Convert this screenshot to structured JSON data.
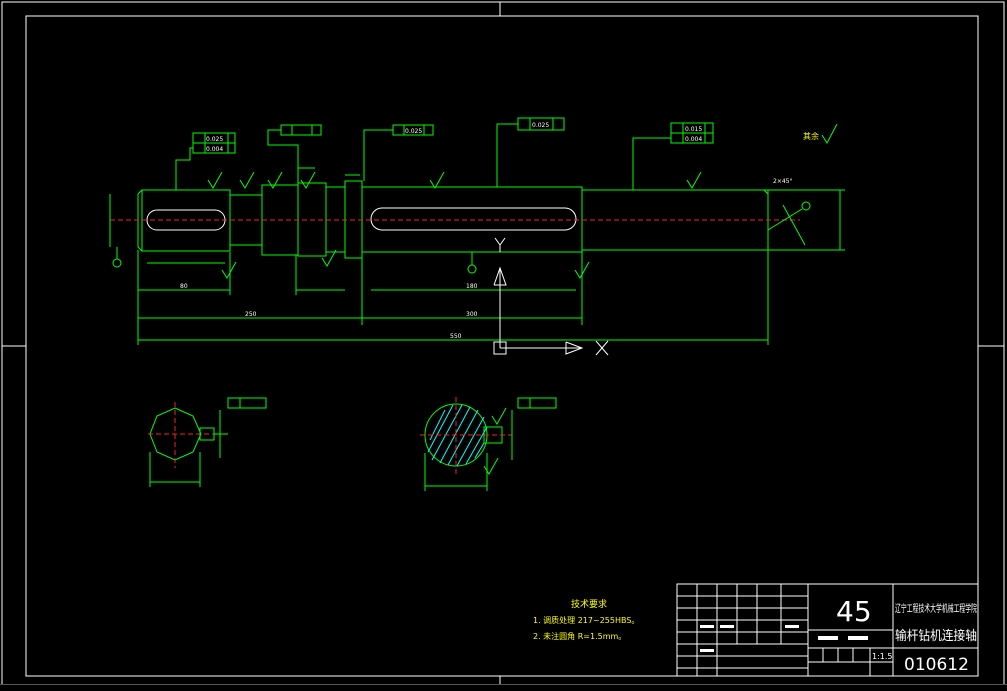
{
  "drawing": {
    "material": "45",
    "scale": "1:1.5",
    "drawing_number": "010612",
    "school": "辽宁工程技术大学机械工程学院",
    "part_name": "输杆钻机连接轴",
    "surface_finish_note": "其余",
    "tech_title": "技术要求",
    "tech_req_1": "1. 调质处理 217~255HBS。",
    "tech_req_2": "2. 未注圆角 R=1.5mm。"
  },
  "dimensions": {
    "overall": "550",
    "left_part": "250",
    "right_part": "300",
    "keyway_long": "180",
    "keyway_short": "80",
    "chamfer": "2×45°",
    "runout_1": "0.025",
    "runout_2": "0.025",
    "runout_3": "0.025",
    "runout_4": "0.015",
    "cyl_tol": "0.004"
  },
  "colors": {
    "background": "#000000",
    "geometry": "#00ff00",
    "border": "#ffffff",
    "centerline": "#ff2020",
    "hatch": "#00ffff",
    "text": "#ffff00"
  }
}
